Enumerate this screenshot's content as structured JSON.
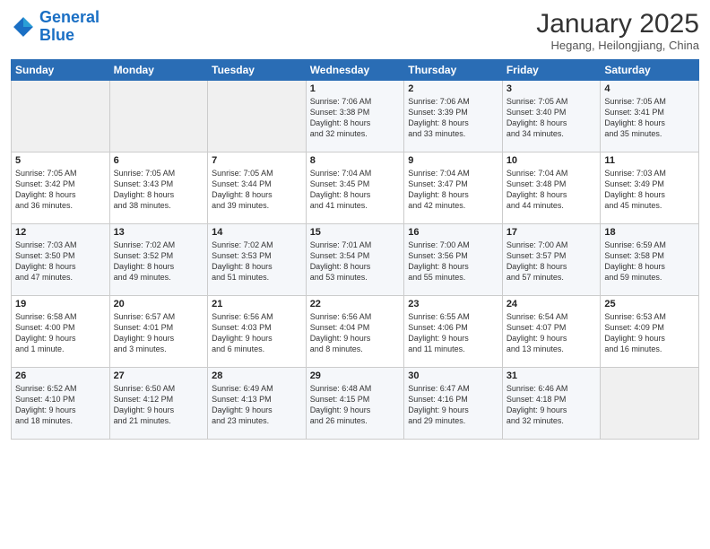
{
  "header": {
    "logo_line1": "General",
    "logo_line2": "Blue",
    "month_title": "January 2025",
    "location": "Hegang, Heilongjiang, China"
  },
  "days_of_week": [
    "Sunday",
    "Monday",
    "Tuesday",
    "Wednesday",
    "Thursday",
    "Friday",
    "Saturday"
  ],
  "weeks": [
    [
      {
        "day": "",
        "content": ""
      },
      {
        "day": "",
        "content": ""
      },
      {
        "day": "",
        "content": ""
      },
      {
        "day": "1",
        "content": "Sunrise: 7:06 AM\nSunset: 3:38 PM\nDaylight: 8 hours\nand 32 minutes."
      },
      {
        "day": "2",
        "content": "Sunrise: 7:06 AM\nSunset: 3:39 PM\nDaylight: 8 hours\nand 33 minutes."
      },
      {
        "day": "3",
        "content": "Sunrise: 7:05 AM\nSunset: 3:40 PM\nDaylight: 8 hours\nand 34 minutes."
      },
      {
        "day": "4",
        "content": "Sunrise: 7:05 AM\nSunset: 3:41 PM\nDaylight: 8 hours\nand 35 minutes."
      }
    ],
    [
      {
        "day": "5",
        "content": "Sunrise: 7:05 AM\nSunset: 3:42 PM\nDaylight: 8 hours\nand 36 minutes."
      },
      {
        "day": "6",
        "content": "Sunrise: 7:05 AM\nSunset: 3:43 PM\nDaylight: 8 hours\nand 38 minutes."
      },
      {
        "day": "7",
        "content": "Sunrise: 7:05 AM\nSunset: 3:44 PM\nDaylight: 8 hours\nand 39 minutes."
      },
      {
        "day": "8",
        "content": "Sunrise: 7:04 AM\nSunset: 3:45 PM\nDaylight: 8 hours\nand 41 minutes."
      },
      {
        "day": "9",
        "content": "Sunrise: 7:04 AM\nSunset: 3:47 PM\nDaylight: 8 hours\nand 42 minutes."
      },
      {
        "day": "10",
        "content": "Sunrise: 7:04 AM\nSunset: 3:48 PM\nDaylight: 8 hours\nand 44 minutes."
      },
      {
        "day": "11",
        "content": "Sunrise: 7:03 AM\nSunset: 3:49 PM\nDaylight: 8 hours\nand 45 minutes."
      }
    ],
    [
      {
        "day": "12",
        "content": "Sunrise: 7:03 AM\nSunset: 3:50 PM\nDaylight: 8 hours\nand 47 minutes."
      },
      {
        "day": "13",
        "content": "Sunrise: 7:02 AM\nSunset: 3:52 PM\nDaylight: 8 hours\nand 49 minutes."
      },
      {
        "day": "14",
        "content": "Sunrise: 7:02 AM\nSunset: 3:53 PM\nDaylight: 8 hours\nand 51 minutes."
      },
      {
        "day": "15",
        "content": "Sunrise: 7:01 AM\nSunset: 3:54 PM\nDaylight: 8 hours\nand 53 minutes."
      },
      {
        "day": "16",
        "content": "Sunrise: 7:00 AM\nSunset: 3:56 PM\nDaylight: 8 hours\nand 55 minutes."
      },
      {
        "day": "17",
        "content": "Sunrise: 7:00 AM\nSunset: 3:57 PM\nDaylight: 8 hours\nand 57 minutes."
      },
      {
        "day": "18",
        "content": "Sunrise: 6:59 AM\nSunset: 3:58 PM\nDaylight: 8 hours\nand 59 minutes."
      }
    ],
    [
      {
        "day": "19",
        "content": "Sunrise: 6:58 AM\nSunset: 4:00 PM\nDaylight: 9 hours\nand 1 minute."
      },
      {
        "day": "20",
        "content": "Sunrise: 6:57 AM\nSunset: 4:01 PM\nDaylight: 9 hours\nand 3 minutes."
      },
      {
        "day": "21",
        "content": "Sunrise: 6:56 AM\nSunset: 4:03 PM\nDaylight: 9 hours\nand 6 minutes."
      },
      {
        "day": "22",
        "content": "Sunrise: 6:56 AM\nSunset: 4:04 PM\nDaylight: 9 hours\nand 8 minutes."
      },
      {
        "day": "23",
        "content": "Sunrise: 6:55 AM\nSunset: 4:06 PM\nDaylight: 9 hours\nand 11 minutes."
      },
      {
        "day": "24",
        "content": "Sunrise: 6:54 AM\nSunset: 4:07 PM\nDaylight: 9 hours\nand 13 minutes."
      },
      {
        "day": "25",
        "content": "Sunrise: 6:53 AM\nSunset: 4:09 PM\nDaylight: 9 hours\nand 16 minutes."
      }
    ],
    [
      {
        "day": "26",
        "content": "Sunrise: 6:52 AM\nSunset: 4:10 PM\nDaylight: 9 hours\nand 18 minutes."
      },
      {
        "day": "27",
        "content": "Sunrise: 6:50 AM\nSunset: 4:12 PM\nDaylight: 9 hours\nand 21 minutes."
      },
      {
        "day": "28",
        "content": "Sunrise: 6:49 AM\nSunset: 4:13 PM\nDaylight: 9 hours\nand 23 minutes."
      },
      {
        "day": "29",
        "content": "Sunrise: 6:48 AM\nSunset: 4:15 PM\nDaylight: 9 hours\nand 26 minutes."
      },
      {
        "day": "30",
        "content": "Sunrise: 6:47 AM\nSunset: 4:16 PM\nDaylight: 9 hours\nand 29 minutes."
      },
      {
        "day": "31",
        "content": "Sunrise: 6:46 AM\nSunset: 4:18 PM\nDaylight: 9 hours\nand 32 minutes."
      },
      {
        "day": "",
        "content": ""
      }
    ]
  ]
}
